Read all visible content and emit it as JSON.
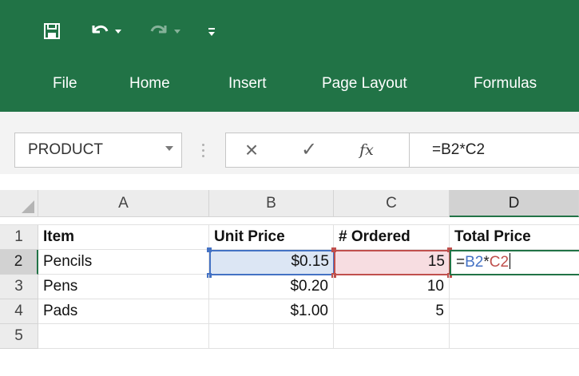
{
  "ribbon": {
    "tabs": [
      {
        "label": "File"
      },
      {
        "label": "Home"
      },
      {
        "label": "Insert"
      },
      {
        "label": "Page Layout"
      },
      {
        "label": "Formulas"
      }
    ],
    "colors": {
      "ribbon_bg": "#217346",
      "text": "#ffffff"
    }
  },
  "quick_access": {
    "icons": [
      "save-icon",
      "undo-icon",
      "undo-dropdown-icon",
      "redo-icon",
      "redo-dropdown-icon",
      "customize-toolbar-icon"
    ]
  },
  "formula_bar": {
    "name_box": "PRODUCT",
    "cancel_icon": "×",
    "enter_icon": "✓",
    "fx_label": "fx",
    "formula": "=B2*C2"
  },
  "sheet": {
    "columns": [
      "A",
      "B",
      "C",
      "D"
    ],
    "active_column": "D",
    "active_row": "2",
    "rows": [
      {
        "num": "1",
        "cells": [
          "Item",
          "Unit Price",
          "# Ordered",
          "Total Price"
        ]
      },
      {
        "num": "2",
        "cells": [
          "Pencils",
          "$0.15",
          "15",
          ""
        ]
      },
      {
        "num": "3",
        "cells": [
          "Pens",
          "$0.20",
          "10",
          ""
        ]
      },
      {
        "num": "4",
        "cells": [
          "Pads",
          "$1.00",
          "5",
          ""
        ]
      },
      {
        "num": "5",
        "cells": [
          "",
          "",
          "",
          ""
        ]
      }
    ],
    "editing_cell": {
      "parts": [
        "=",
        "B2",
        "*",
        "C2"
      ],
      "colors": {
        "B2": "#4472c4",
        "C2": "#c0504d"
      }
    }
  }
}
